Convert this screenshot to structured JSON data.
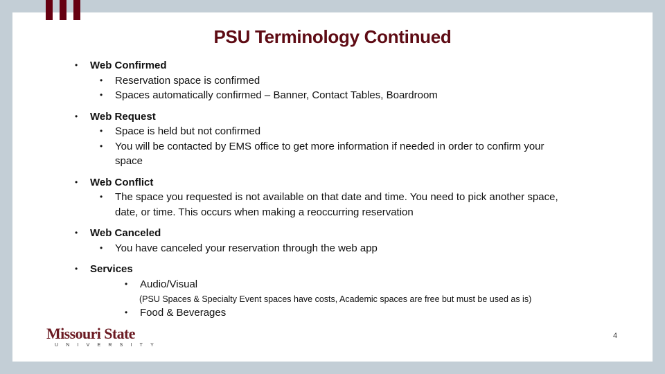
{
  "slide": {
    "title": "PSU Terminology  Continued",
    "page_number": "4",
    "accent_color": "#660011",
    "title_color": "#5E0B14",
    "background_color": "#C3CED6"
  },
  "sections": [
    {
      "heading": "Web Confirmed",
      "items": [
        "Reservation space is confirmed",
        "Spaces automatically confirmed – Banner, Contact Tables, Boardroom"
      ]
    },
    {
      "heading": "Web Request",
      "items": [
        "Space is held but not confirmed",
        "You will be contacted by EMS office to get more information if needed in order to confirm your space"
      ]
    },
    {
      "heading": "Web Conflict",
      "items": [
        "The space you requested is not available on that date and time.  You need to pick another space, date, or time.  This occurs when making a reoccurring reservation"
      ]
    },
    {
      "heading": "Web Canceled",
      "items": [
        "You have canceled your reservation through the web app"
      ]
    },
    {
      "heading": "Services",
      "items": [
        "Audio/Visual",
        "Food & Beverages"
      ],
      "note": "(PSU Spaces & Specialty Event spaces have costs, Academic spaces are free but must be used as is)"
    }
  ],
  "logo": {
    "name": "Missouri State",
    "subtitle": "UNIVERSITY"
  },
  "bullet_glyph": "•"
}
